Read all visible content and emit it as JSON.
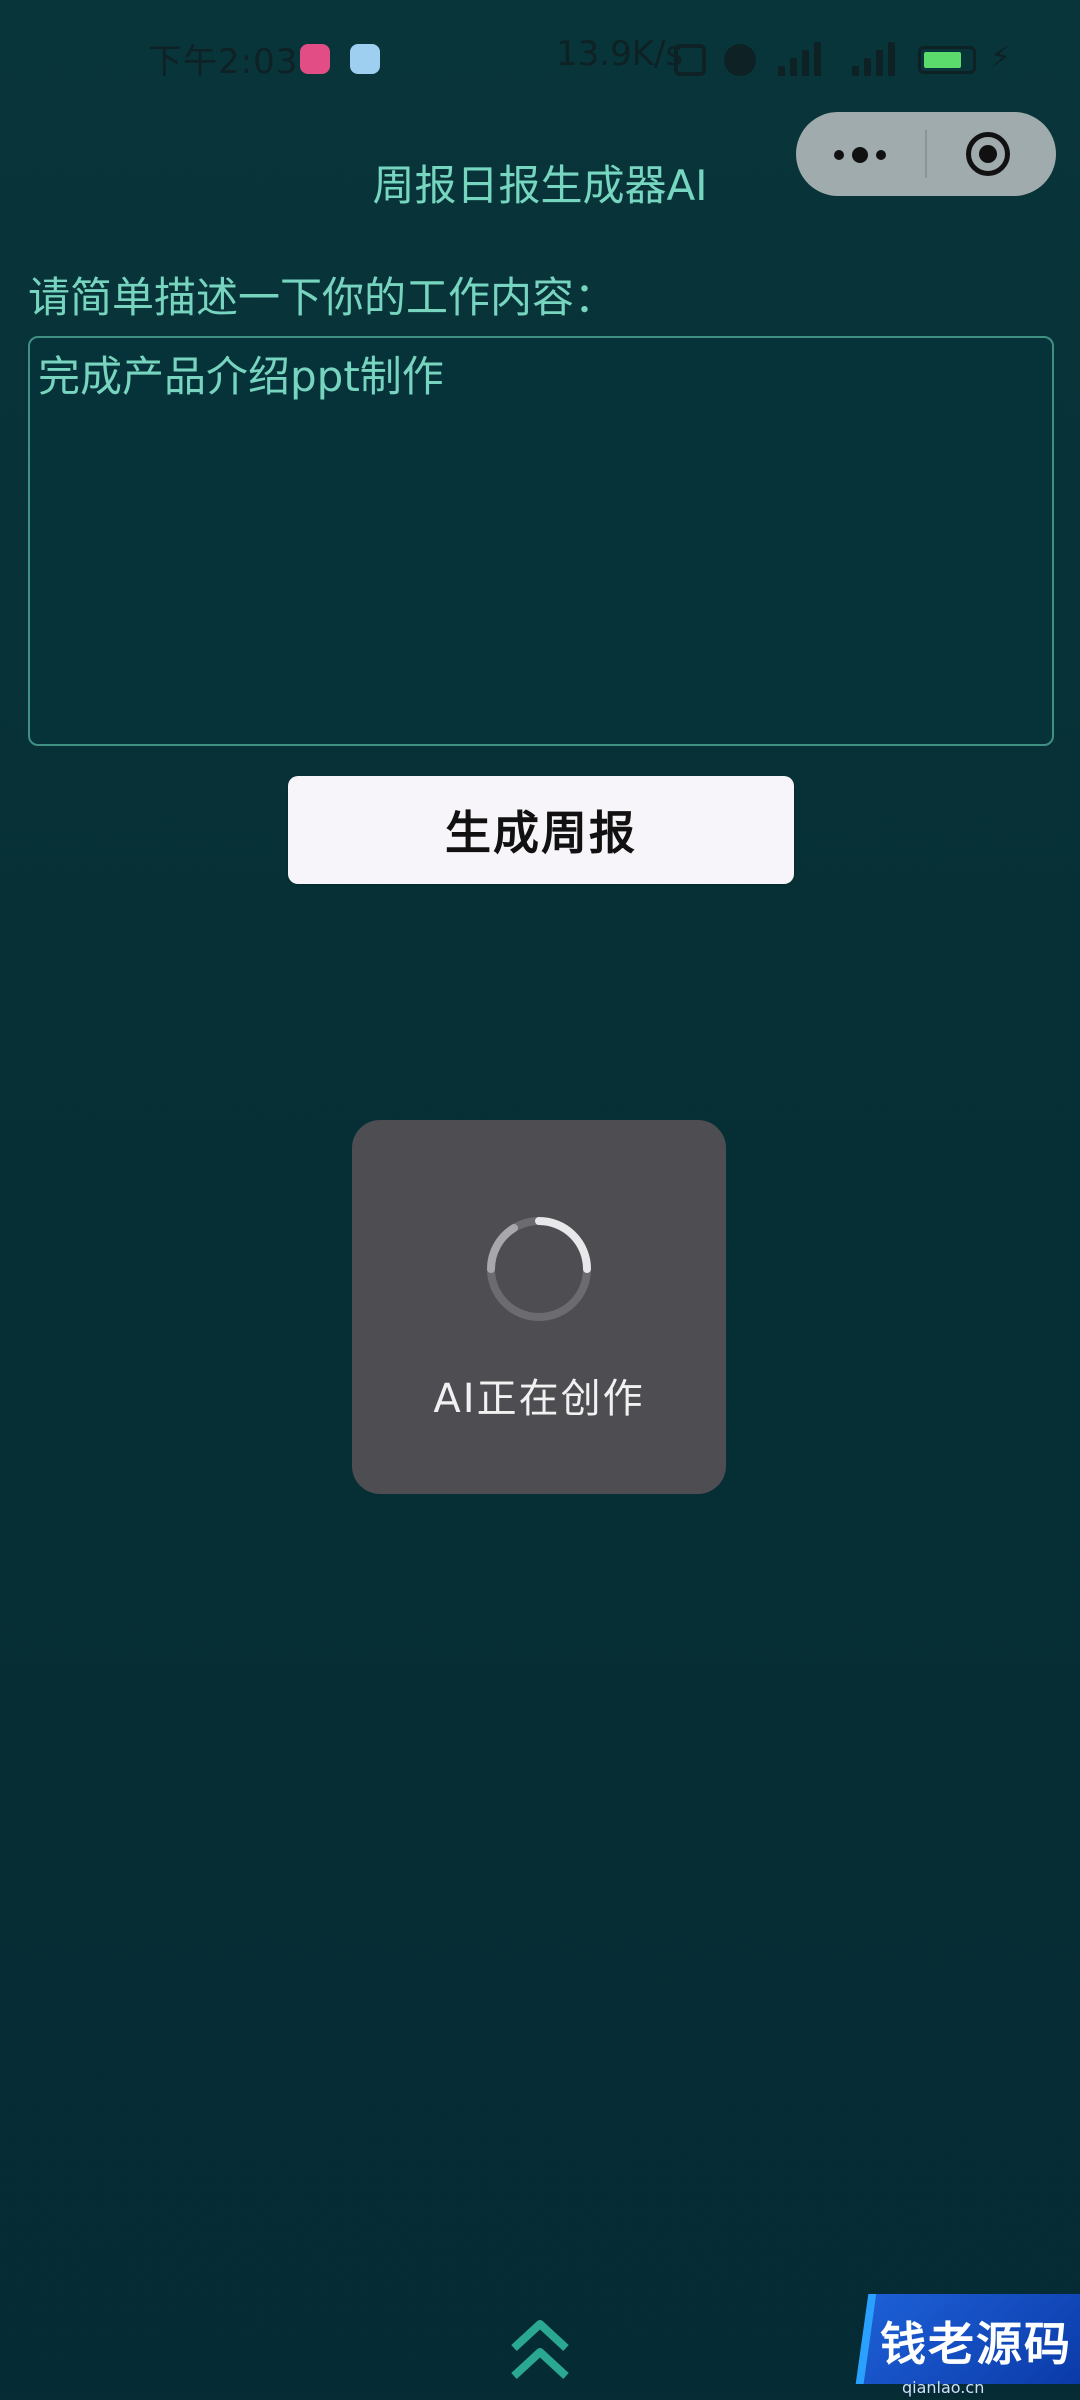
{
  "status_bar": {
    "time": "下午2:03",
    "speed": "13.9K/s",
    "icons": [
      "nfc-icon",
      "alarm-icon",
      "signal-icon",
      "signal-icon",
      "battery-icon",
      "charging-icon"
    ]
  },
  "header": {
    "title": "周报日报生成器AI",
    "capsule_icons": [
      "more-icon",
      "close-target-icon"
    ]
  },
  "form": {
    "label": "请简单描述一下你的工作内容：",
    "textarea_value": "完成产品介绍ppt制作",
    "button_label": "生成周报"
  },
  "loading": {
    "text": "AI正在创作"
  },
  "footer": {
    "scroll_icon": "double-chevron-up-icon",
    "watermark": "钱老源码",
    "watermark_sub": "qianlao.cn"
  },
  "colors": {
    "background": "#062f35",
    "accent_text": "#77d4bf",
    "button_bg": "#f7f5fa",
    "toast_bg": "#4e4d52"
  }
}
